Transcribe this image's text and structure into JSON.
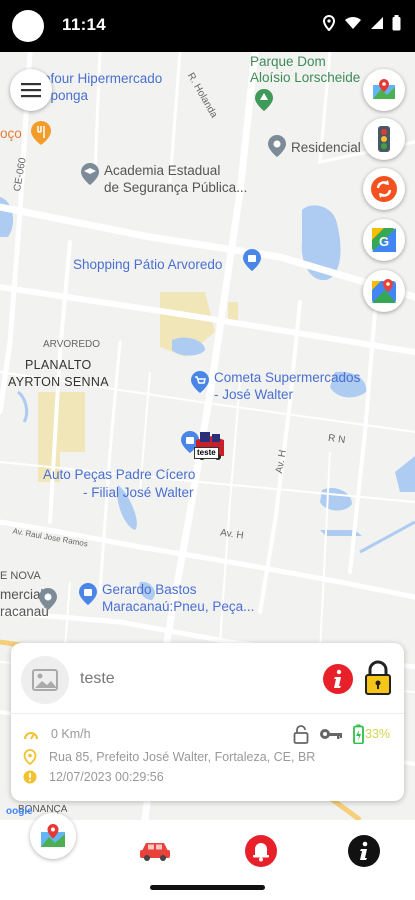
{
  "status_bar": {
    "time": "11:14"
  },
  "map": {
    "labels": {
      "hipermercado_1": "efour Hipermercado",
      "hipermercado_2": "oponga",
      "rua_holanda": "R. Holanda",
      "parque_1": "Parque Dom",
      "parque_2": "Aloísio Lorscheide",
      "oco": "oço",
      "residencial": "Residencial",
      "academia_1": "Academia Estadual",
      "academia_2": "de Segurança Pública...",
      "ce060": "CE-060",
      "shopping": "Shopping Pátio Arvoredo",
      "arvoredo": "ARVOREDO",
      "planalto_1": "PLANALTO",
      "planalto_2": "AYRTON SENNA",
      "cometa_1": "Cometa Supermercados",
      "cometa_2": "- José Walter",
      "rn": "R N",
      "autopecas_1": "Auto Peças Padre Cícero",
      "autopecas_2": "- Filial José Walter",
      "marker_label": "teste",
      "av_h": "Av. H",
      "av_h2": "Av. H",
      "av_raul": "Av. Raul Jose Ramos",
      "nova": "E NOVA",
      "comercial": "mercial",
      "maracanau": "racanaú",
      "gerardo_1": "Gerardo Bastos",
      "gerardo_2": "Maracanaú:Pneu, Peça...",
      "bonanca": "BONANÇA",
      "google": "oogle"
    }
  },
  "side_buttons": [
    {
      "icon": "maps-icon"
    },
    {
      "icon": "traffic-light-icon"
    },
    {
      "icon": "refresh-icon"
    },
    {
      "icon": "google-maps-icon"
    },
    {
      "icon": "google-maps-pin-icon"
    }
  ],
  "vehicle_card": {
    "name": "teste",
    "speed": "0 Km/h",
    "address": "Rua 85, Prefeito José Walter, Fortaleza, CE, BR",
    "datetime": "12/07/2023 00:29:56",
    "battery": "33%"
  },
  "bottom_nav": {
    "items": [
      {
        "icon": "map-icon"
      },
      {
        "icon": "car-icon"
      },
      {
        "icon": "bell-icon"
      },
      {
        "icon": "info-icon"
      }
    ]
  },
  "colors": {
    "accent_red": "#e8202a",
    "lock_yellow": "#f5c518",
    "battery_green": "#2fbf4a",
    "map_water": "#aecbf2",
    "map_park": "#f0e6b8"
  }
}
